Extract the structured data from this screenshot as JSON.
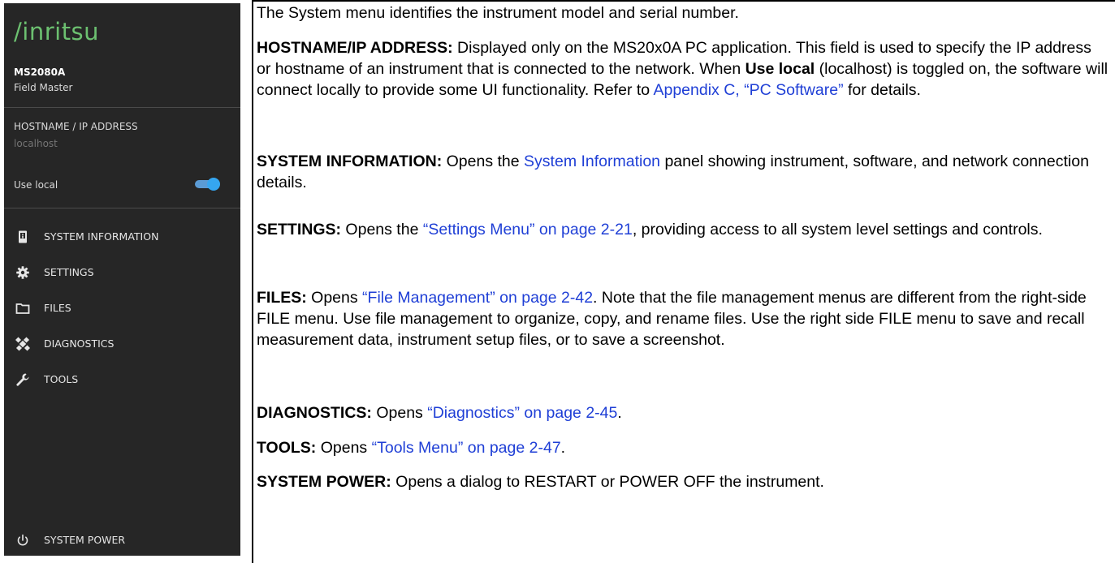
{
  "panel": {
    "logo": "/inritsu",
    "model": "MS2080A",
    "model_name": "Field Master",
    "hostname_label": "HOSTNAME / IP ADDRESS",
    "hostname_placeholder": "localhost",
    "use_local_label": "Use local",
    "use_local_on": true,
    "menu": [
      {
        "label": "SYSTEM INFORMATION",
        "icon": "device-info-icon"
      },
      {
        "label": "SETTINGS",
        "icon": "gear-icon"
      },
      {
        "label": "FILES",
        "icon": "folder-icon"
      },
      {
        "label": "DIAGNOSTICS",
        "icon": "satellite-icon"
      },
      {
        "label": "TOOLS",
        "icon": "wrench-icon"
      }
    ],
    "power_label": "SYSTEM POWER",
    "power_icon": "power-icon",
    "accent_color": "#35a6f0",
    "logo_color": "#6cc070"
  },
  "doc": {
    "intro": "The System menu identifies the instrument model and serial number.",
    "hostname": {
      "term": "HOSTNAME/IP ADDRESS:",
      "t1": "  Displayed only on the MS20x0A PC application. This field is used to specify the IP address or hostname of an instrument that is connected to the network. When ",
      "bold": "Use local",
      "t2": " (localhost) is toggled on, the software will connect locally to provide some UI functionality. Refer to ",
      "link": "Appendix C, “PC Software”",
      "t3": " for details."
    },
    "sysinfo": {
      "term": "SYSTEM INFORMATION:",
      "t1": "  Opens the ",
      "link": "System Information",
      "t2": " panel showing instrument, software, and network connection details."
    },
    "settings": {
      "term": "SETTINGS:",
      "t1": "  Opens the ",
      "link": "“Settings Menu” on page 2-21",
      "t2": ", providing access to all system level settings and controls."
    },
    "files": {
      "term": "FILES:",
      "t1": "  Opens ",
      "link": "“File Management” on page 2-42",
      "t2": ". Note that the file management menus are different from the right-side FILE menu. Use file management to organize, copy, and rename files. Use the right side FILE menu to save and recall measurement data, instrument setup files, or to save a screenshot."
    },
    "diagnostics": {
      "term": "DIAGNOSTICS:",
      "t1": "  Opens ",
      "link": "“Diagnostics” on page 2-45",
      "t2": "."
    },
    "tools": {
      "term": "TOOLS:",
      "t1": "  Opens ",
      "link": "“Tools Menu” on page 2-47",
      "t2": "."
    },
    "power": {
      "term": "SYSTEM POWER:",
      "t1": "  Opens a dialog to RESTART or POWER OFF the instrument."
    },
    "link_color": "#1f3fd6"
  }
}
